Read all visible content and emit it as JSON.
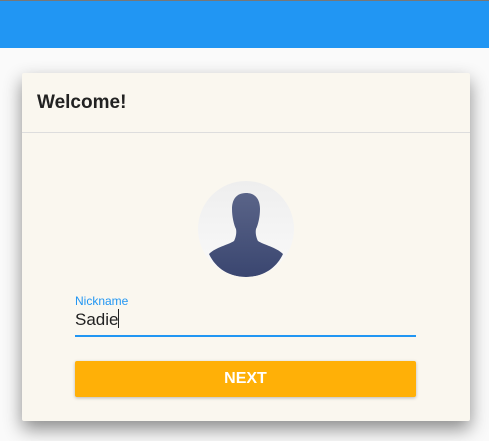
{
  "colors": {
    "appbar": "#2196f3",
    "accent": "#2196f3",
    "button": "#ffb007",
    "card": "#faf7ef"
  },
  "dialog": {
    "title": "Welcome!",
    "avatar_icon": "person-silhouette-icon",
    "nickname": {
      "label": "Nickname",
      "value": "Sadie"
    },
    "next_label": "NEXT"
  }
}
